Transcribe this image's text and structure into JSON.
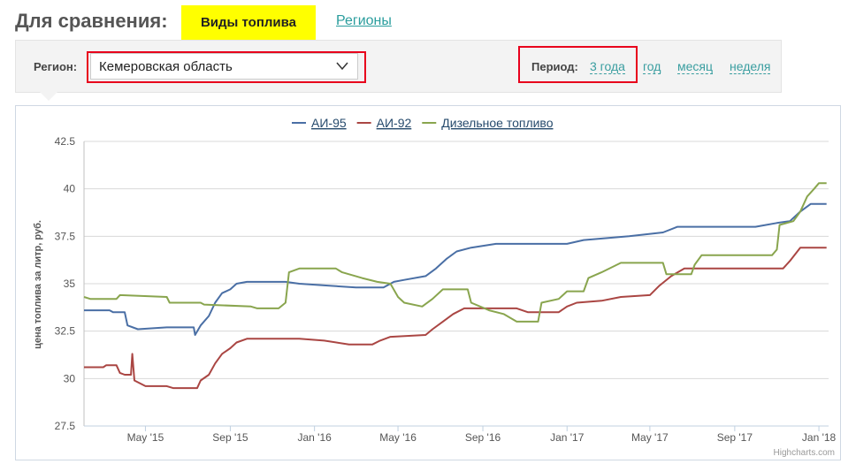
{
  "header": {
    "compare_label": "Для сравнения:",
    "tab_active": "Виды топлива",
    "tab_link": "Регионы"
  },
  "filters": {
    "region_label": "Регион:",
    "region_value": "Кемеровская область",
    "period_label": "Период:",
    "periods": [
      "3 года",
      "год",
      "месяц",
      "неделя"
    ],
    "active_period": "3 года",
    "highlight_color": "#e8001c",
    "link_color": "#3a9ea0"
  },
  "credits": "Highcharts.com",
  "chart_data": {
    "type": "line",
    "ylabel": "цена топлива за литр, руб.",
    "ylim": [
      27.5,
      42.5
    ],
    "yticks": [
      27.5,
      30,
      32.5,
      35,
      37.5,
      40,
      42.5
    ],
    "xticks": [
      {
        "label": "May '15",
        "date": "2015-05-01"
      },
      {
        "label": "Sep '15",
        "date": "2015-09-01"
      },
      {
        "label": "Jan '16",
        "date": "2016-01-01"
      },
      {
        "label": "May '16",
        "date": "2016-05-01"
      },
      {
        "label": "Sep '16",
        "date": "2016-09-01"
      },
      {
        "label": "Jan '17",
        "date": "2017-01-01"
      },
      {
        "label": "May '17",
        "date": "2017-05-01"
      },
      {
        "label": "Sep '17",
        "date": "2017-09-01"
      },
      {
        "label": "Jan '18",
        "date": "2018-01-01"
      }
    ],
    "xlim": [
      "2015-02-01",
      "2018-01-15"
    ],
    "legend_position": "top-center",
    "grid": true,
    "series": [
      {
        "name": "АИ-95",
        "color": "#4a6fa5",
        "points": [
          [
            "2015-02-01",
            33.6
          ],
          [
            "2015-03-10",
            33.6
          ],
          [
            "2015-03-15",
            33.5
          ],
          [
            "2015-04-01",
            33.5
          ],
          [
            "2015-04-05",
            32.8
          ],
          [
            "2015-04-20",
            32.6
          ],
          [
            "2015-06-01",
            32.7
          ],
          [
            "2015-07-10",
            32.7
          ],
          [
            "2015-07-12",
            32.3
          ],
          [
            "2015-07-20",
            32.8
          ],
          [
            "2015-08-01",
            33.3
          ],
          [
            "2015-08-10",
            34.0
          ],
          [
            "2015-08-20",
            34.5
          ],
          [
            "2015-09-01",
            34.7
          ],
          [
            "2015-09-10",
            35.0
          ],
          [
            "2015-09-25",
            35.1
          ],
          [
            "2015-11-20",
            35.1
          ],
          [
            "2015-12-10",
            35.0
          ],
          [
            "2016-01-20",
            34.9
          ],
          [
            "2016-03-01",
            34.8
          ],
          [
            "2016-04-10",
            34.8
          ],
          [
            "2016-04-25",
            35.1
          ],
          [
            "2016-05-10",
            35.2
          ],
          [
            "2016-06-10",
            35.4
          ],
          [
            "2016-06-25",
            35.8
          ],
          [
            "2016-07-10",
            36.3
          ],
          [
            "2016-07-25",
            36.7
          ],
          [
            "2016-08-15",
            36.9
          ],
          [
            "2016-09-20",
            37.1
          ],
          [
            "2017-01-01",
            37.1
          ],
          [
            "2017-01-25",
            37.3
          ],
          [
            "2017-04-01",
            37.5
          ],
          [
            "2017-05-20",
            37.7
          ],
          [
            "2017-06-10",
            38.0
          ],
          [
            "2017-10-01",
            38.0
          ],
          [
            "2017-11-01",
            38.2
          ],
          [
            "2017-11-20",
            38.3
          ],
          [
            "2017-12-05",
            38.8
          ],
          [
            "2017-12-20",
            39.2
          ],
          [
            "2018-01-12",
            39.2
          ]
        ]
      },
      {
        "name": "АИ-92",
        "color": "#aa4643",
        "points": [
          [
            "2015-02-01",
            30.6
          ],
          [
            "2015-03-01",
            30.6
          ],
          [
            "2015-03-05",
            30.7
          ],
          [
            "2015-03-20",
            30.7
          ],
          [
            "2015-03-25",
            30.3
          ],
          [
            "2015-04-01",
            30.2
          ],
          [
            "2015-04-10",
            30.2
          ],
          [
            "2015-04-12",
            31.3
          ],
          [
            "2015-04-15",
            29.9
          ],
          [
            "2015-05-01",
            29.6
          ],
          [
            "2015-06-01",
            29.6
          ],
          [
            "2015-06-10",
            29.5
          ],
          [
            "2015-07-15",
            29.5
          ],
          [
            "2015-07-20",
            29.9
          ],
          [
            "2015-08-01",
            30.2
          ],
          [
            "2015-08-10",
            30.8
          ],
          [
            "2015-08-20",
            31.3
          ],
          [
            "2015-09-01",
            31.6
          ],
          [
            "2015-09-10",
            31.9
          ],
          [
            "2015-09-25",
            32.1
          ],
          [
            "2015-12-10",
            32.1
          ],
          [
            "2016-01-15",
            32.0
          ],
          [
            "2016-02-20",
            31.8
          ],
          [
            "2016-03-25",
            31.8
          ],
          [
            "2016-04-05",
            32.0
          ],
          [
            "2016-04-20",
            32.2
          ],
          [
            "2016-06-10",
            32.3
          ],
          [
            "2016-06-20",
            32.6
          ],
          [
            "2016-07-05",
            33.0
          ],
          [
            "2016-07-20",
            33.4
          ],
          [
            "2016-08-05",
            33.7
          ],
          [
            "2016-10-20",
            33.7
          ],
          [
            "2016-11-05",
            33.5
          ],
          [
            "2016-12-20",
            33.5
          ],
          [
            "2017-01-01",
            33.8
          ],
          [
            "2017-01-15",
            34.0
          ],
          [
            "2017-02-20",
            34.1
          ],
          [
            "2017-03-20",
            34.3
          ],
          [
            "2017-05-01",
            34.4
          ],
          [
            "2017-05-15",
            34.9
          ],
          [
            "2017-06-01",
            35.4
          ],
          [
            "2017-06-20",
            35.8
          ],
          [
            "2017-11-10",
            35.8
          ],
          [
            "2017-11-20",
            36.2
          ],
          [
            "2017-12-05",
            36.9
          ],
          [
            "2018-01-12",
            36.9
          ]
        ]
      },
      {
        "name": "Дизельное топливо",
        "color": "#89a54e",
        "points": [
          [
            "2015-02-01",
            34.3
          ],
          [
            "2015-02-10",
            34.2
          ],
          [
            "2015-03-20",
            34.2
          ],
          [
            "2015-03-25",
            34.4
          ],
          [
            "2015-06-01",
            34.3
          ],
          [
            "2015-06-05",
            34.0
          ],
          [
            "2015-07-20",
            34.0
          ],
          [
            "2015-07-25",
            33.9
          ],
          [
            "2015-10-01",
            33.8
          ],
          [
            "2015-10-10",
            33.7
          ],
          [
            "2015-11-10",
            33.7
          ],
          [
            "2015-11-20",
            34.0
          ],
          [
            "2015-11-25",
            35.6
          ],
          [
            "2015-12-10",
            35.8
          ],
          [
            "2016-02-01",
            35.8
          ],
          [
            "2016-02-10",
            35.6
          ],
          [
            "2016-03-10",
            35.3
          ],
          [
            "2016-04-01",
            35.1
          ],
          [
            "2016-04-20",
            35.0
          ],
          [
            "2016-05-01",
            34.3
          ],
          [
            "2016-05-10",
            34.0
          ],
          [
            "2016-06-05",
            33.8
          ],
          [
            "2016-06-20",
            34.2
          ],
          [
            "2016-07-05",
            34.7
          ],
          [
            "2016-08-10",
            34.7
          ],
          [
            "2016-08-15",
            34.0
          ],
          [
            "2016-09-10",
            33.6
          ],
          [
            "2016-10-01",
            33.4
          ],
          [
            "2016-10-20",
            33.0
          ],
          [
            "2016-11-20",
            33.0
          ],
          [
            "2016-11-25",
            34.0
          ],
          [
            "2016-12-20",
            34.2
          ],
          [
            "2017-01-01",
            34.6
          ],
          [
            "2017-01-25",
            34.6
          ],
          [
            "2017-02-01",
            35.3
          ],
          [
            "2017-02-20",
            35.6
          ],
          [
            "2017-03-20",
            36.1
          ],
          [
            "2017-05-20",
            36.1
          ],
          [
            "2017-05-25",
            35.5
          ],
          [
            "2017-06-30",
            35.5
          ],
          [
            "2017-07-05",
            36.0
          ],
          [
            "2017-07-15",
            36.5
          ],
          [
            "2017-10-25",
            36.5
          ],
          [
            "2017-11-01",
            36.8
          ],
          [
            "2017-11-05",
            38.1
          ],
          [
            "2017-11-25",
            38.3
          ],
          [
            "2017-12-05",
            38.8
          ],
          [
            "2017-12-15",
            39.6
          ],
          [
            "2017-12-25",
            40.0
          ],
          [
            "2018-01-01",
            40.3
          ],
          [
            "2018-01-12",
            40.3
          ]
        ]
      }
    ]
  }
}
